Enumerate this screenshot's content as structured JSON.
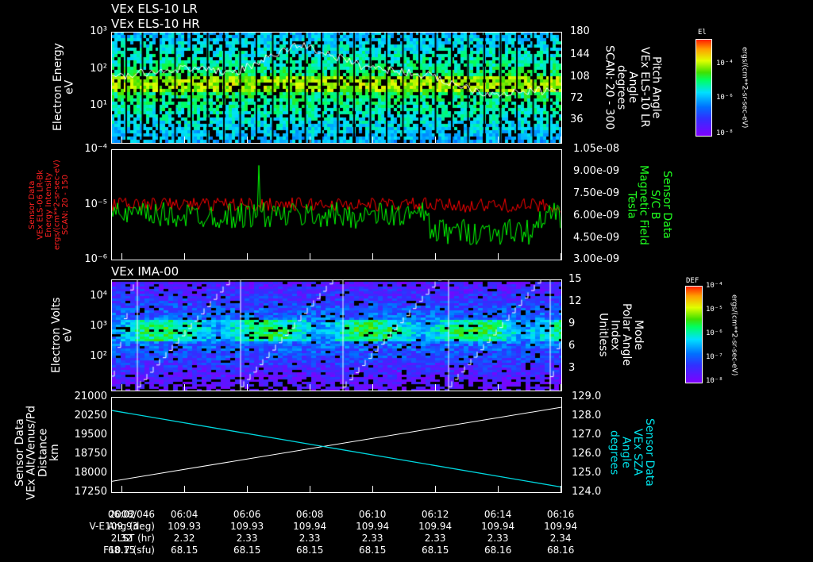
{
  "panel1": {
    "title1": "VEx ELS-10 LR",
    "title2": "VEx ELS-10 HR",
    "left_label": [
      "Electron Energy",
      "eV"
    ],
    "left_ticks": [
      "10³",
      "10²",
      "10¹"
    ],
    "right_ticks": [
      "180",
      "144",
      "108",
      "72",
      "36"
    ],
    "right_label": [
      "Pitch Angle",
      "VEx ELS-10 LR",
      "Angle",
      "degrees",
      "SCAN: 20 - 300"
    ],
    "colorbar": {
      "title": "El",
      "ticks": [
        "10⁻⁴",
        "10⁻⁶",
        "10⁻⁸"
      ],
      "units": "ergs/(cm**2-sr-sec-eV)"
    }
  },
  "panel2": {
    "left_label": [
      "Sensor Data",
      "VEx ELS-06 LR-Bk",
      "Energy Intensity",
      "ergs/(cm**2-sr-sec-eV)",
      "SCAN: 20 - 150"
    ],
    "left_ticks": [
      "10⁻⁴",
      "10⁻⁵",
      "10⁻⁶"
    ],
    "right_ticks": [
      "1.05e-08",
      "9.00e-09",
      "7.50e-09",
      "6.00e-09",
      "4.50e-09",
      "3.00e-09"
    ],
    "right_label": [
      "Sensor Data",
      "S/C B",
      "Magnetic Field",
      "Tesla"
    ]
  },
  "panel3": {
    "title": "VEx IMA-00",
    "left_label": [
      "Electron Volts",
      "eV"
    ],
    "left_ticks": [
      "10⁴",
      "10³",
      "10²"
    ],
    "right_ticks": [
      "15",
      "12",
      "9",
      "6",
      "3"
    ],
    "right_label": [
      "Mode",
      "Polar Angle",
      "Index",
      "Unitless"
    ],
    "colorbar": {
      "title": "DEF",
      "ticks": [
        "10⁻⁴",
        "10⁻⁵",
        "10⁻⁶",
        "10⁻⁷",
        "10⁻⁸"
      ],
      "units": "ergs/(cm**2-sr-sec-eV)"
    }
  },
  "panel4": {
    "left_label": [
      "Sensor Data",
      "VEx Alt/Venus/Pd",
      "Distance",
      "km"
    ],
    "left_ticks": [
      "21000",
      "20250",
      "19500",
      "18750",
      "18000",
      "17250"
    ],
    "right_ticks": [
      "129.0",
      "128.0",
      "127.0",
      "126.0",
      "125.0",
      "124.0"
    ],
    "right_label": [
      "Sensor Data",
      "VEx SZA",
      "Angle",
      "degrees"
    ]
  },
  "xaxis": {
    "date": "2008/046",
    "times": [
      "06:02",
      "06:04",
      "06:06",
      "06:08",
      "06:10",
      "06:12",
      "06:14",
      "06:16"
    ],
    "rows": [
      {
        "label": "V-E Ang (deg)",
        "values": [
          "109.93",
          "109.93",
          "109.93",
          "109.94",
          "109.94",
          "109.94",
          "109.94",
          "109.94"
        ]
      },
      {
        "label": "LST (hr)",
        "values": [
          "2.32",
          "2.32",
          "2.33",
          "2.33",
          "2.33",
          "2.33",
          "2.33",
          "2.34"
        ]
      },
      {
        "label": "F10.7 (sfu)",
        "values": [
          "68.15",
          "68.15",
          "68.15",
          "68.15",
          "68.15",
          "68.15",
          "68.16",
          "68.16"
        ]
      }
    ]
  },
  "chart_data": [
    {
      "type": "heatmap",
      "title": "VEx ELS-10 LR / HR",
      "ylabel": "Electron Energy (eV)",
      "ylim": [
        1,
        1000
      ],
      "yscale": "log",
      "y2label": "Pitch Angle (degrees)",
      "y2lim": [
        0,
        180
      ],
      "xlim": [
        "06:01:40",
        "06:16:00"
      ],
      "peak_energy_eV": 40,
      "pitch_angle_line": {
        "x_min": [
          0,
          2,
          4,
          6,
          8,
          10,
          12,
          14.3
        ],
        "deg": [
          105,
          120,
          115,
          160,
          125,
          110,
          80,
          85
        ]
      }
    },
    {
      "type": "line",
      "ylim_left": [
        1e-06,
        0.0001
      ],
      "ylim_right": [
        3e-09,
        1.05e-08
      ],
      "series": [
        {
          "name": "VEx ELS-06 LR-Bk Energy Intensity",
          "color": "#ff0000",
          "typical": 1e-05
        },
        {
          "name": "S/C B Magnetic Field (Tesla)",
          "color": "#00ff00",
          "typical": 6e-09
        }
      ]
    },
    {
      "type": "heatmap",
      "title": "VEx IMA-00",
      "ylabel": "Electron Volts (eV)",
      "ylim": [
        10,
        30000
      ],
      "yscale": "log",
      "y2label": "Mode Polar Angle Index",
      "y2lim": [
        0,
        15
      ],
      "peak_energy_eV": 800
    },
    {
      "type": "line",
      "ylim_left": [
        17250,
        21000
      ],
      "ylim_right": [
        124.0,
        129.0
      ],
      "series": [
        {
          "name": "VEx Alt/Venus/Pd Distance (km)",
          "color": "#ffffff",
          "x": [
            "06:01:40",
            "06:16:00"
          ],
          "y": [
            17700,
            20600
          ]
        },
        {
          "name": "VEx SZA Angle (degrees)",
          "color": "#00e0e0",
          "x": [
            "06:01:40",
            "06:16:00"
          ],
          "y": [
            128.3,
            124.3
          ]
        }
      ]
    }
  ]
}
